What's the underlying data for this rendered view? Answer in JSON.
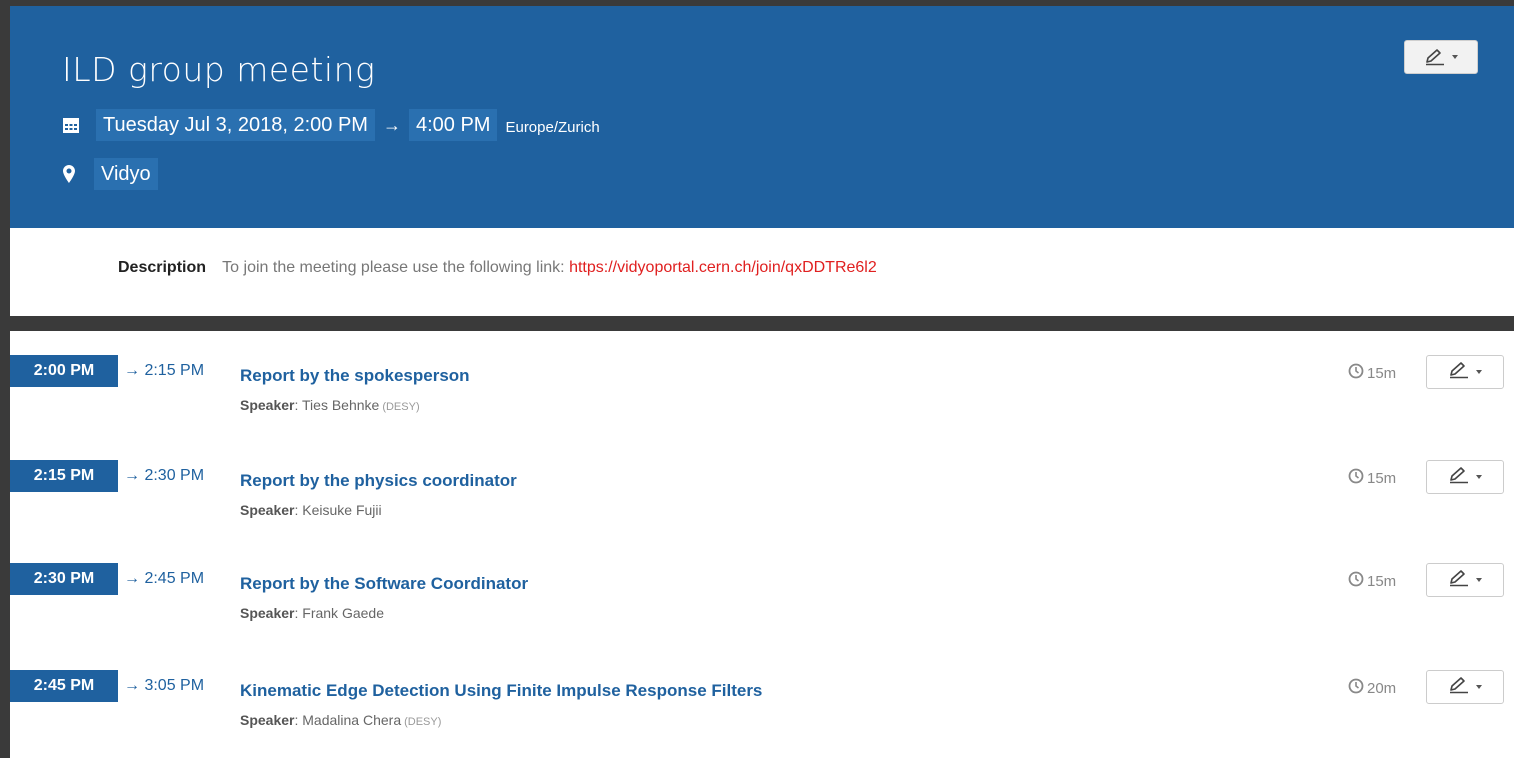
{
  "colors": {
    "header_bg": "#1f619f",
    "chip_bg": "#2a70b0",
    "link_red": "#e02020",
    "accent": "#1f619f"
  },
  "header": {
    "title": "ILD group meeting",
    "edit_icon": "pencil-icon",
    "start_datetime": "Tuesday Jul 3, 2018, 2:00 PM",
    "arrow": "→",
    "end_time": "4:00 PM",
    "timezone": "Europe/Zurich",
    "location": "Vidyo"
  },
  "description": {
    "label": "Description",
    "text": "To join the meeting please use the following link:",
    "link": "https://vidyoportal.cern.ch/join/qxDDTRe6l2"
  },
  "timetable": {
    "speaker_label": "Speaker",
    "entries": [
      {
        "start": "2:00 PM",
        "end": "→ 2:15 PM",
        "title": "Report by the spokesperson",
        "speaker": "Ties Behnke",
        "affiliation": "(DESY)",
        "duration": "15m"
      },
      {
        "start": "2:15 PM",
        "end": "→ 2:30 PM",
        "title": "Report by the physics coordinator",
        "speaker": "Keisuke Fujii",
        "affiliation": "",
        "duration": "15m"
      },
      {
        "start": "2:30 PM",
        "end": "→ 2:45 PM",
        "title": "Report by the Software Coordinator",
        "speaker": "Frank Gaede",
        "affiliation": "",
        "duration": "15m"
      },
      {
        "start": "2:45 PM",
        "end": "→ 3:05 PM",
        "title": "Kinematic Edge Detection Using Finite Impulse Response Filters",
        "speaker": "Madalina Chera",
        "affiliation": "(DESY)",
        "duration": "20m"
      }
    ]
  }
}
